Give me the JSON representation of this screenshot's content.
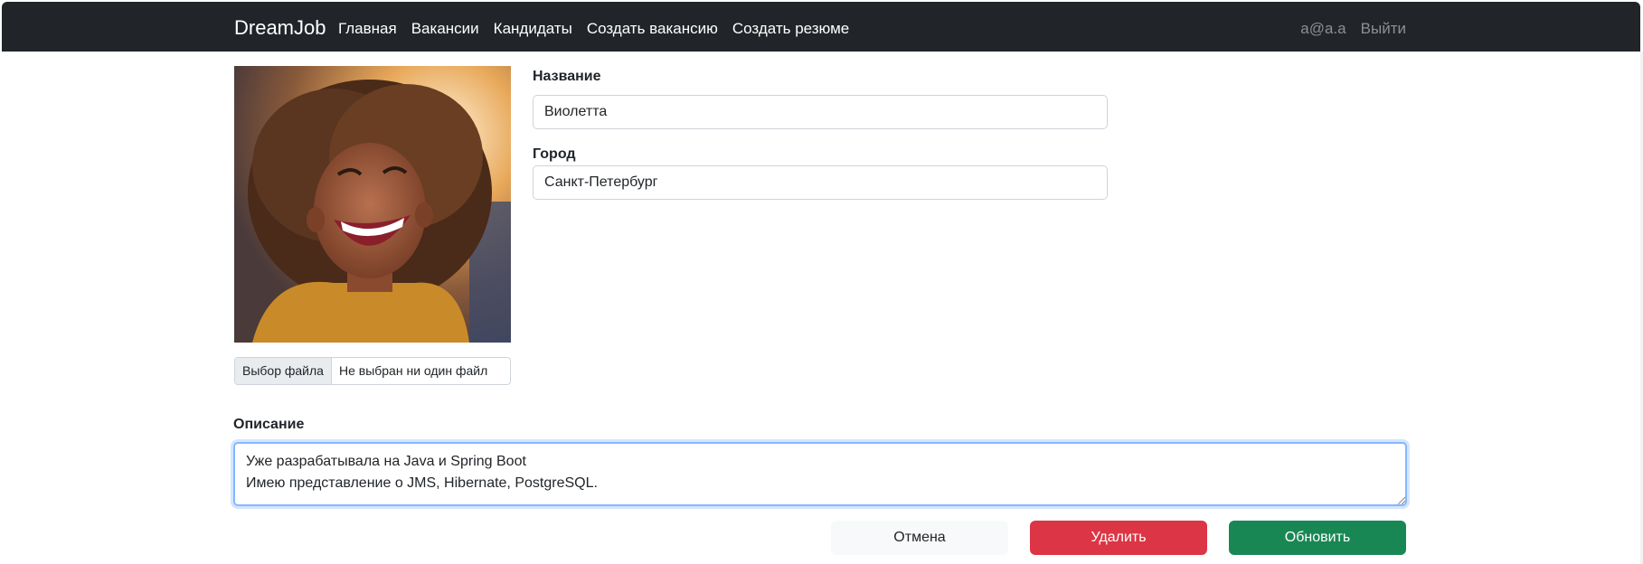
{
  "navbar": {
    "brand": "DreamJob",
    "links": [
      "Главная",
      "Вакансии",
      "Кандидаты",
      "Создать вакансию",
      "Создать резюме"
    ],
    "user": "a@a.a",
    "logout": "Выйти",
    "background": "#212529"
  },
  "photo": {
    "description_icon": "candidate-photo"
  },
  "file_input": {
    "button_label": "Выбор файла",
    "status": "Не выбран ни один файл"
  },
  "form": {
    "name_label": "Название",
    "name_value": "Виолетта",
    "city_label": "Город",
    "city_value": "Санкт-Петербург",
    "description_label": "Описание",
    "description_value": "Уже разрабатывала на Java и Spring Boot\nИмею представление о JMS, Hibernate, PostgreSQL."
  },
  "buttons": {
    "cancel": "Отмена",
    "delete": "Удалить",
    "update": "Обновить"
  },
  "colors": {
    "danger": "#dc3545",
    "success": "#198754",
    "light": "#f8f9fa",
    "focus": "#86b7fe"
  }
}
